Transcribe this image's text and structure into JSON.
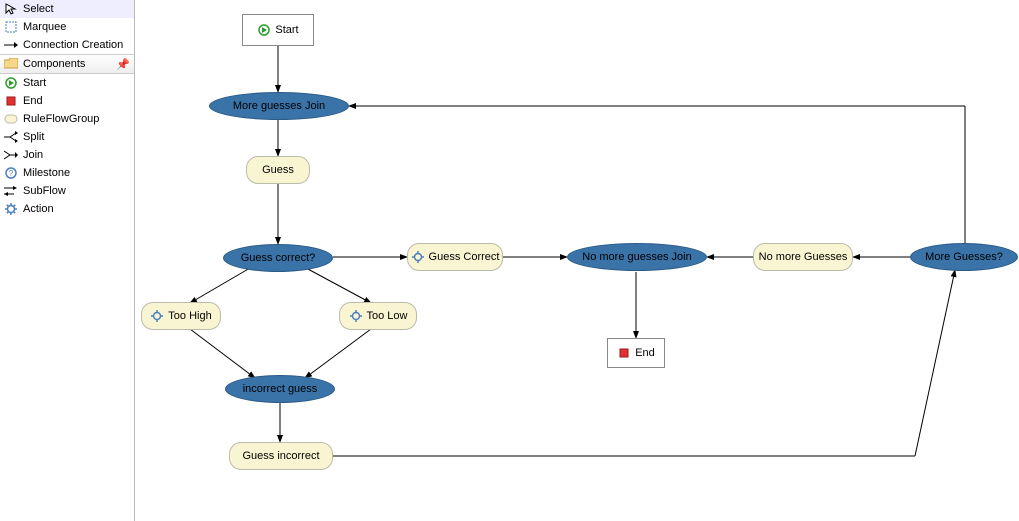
{
  "palette": {
    "tools": {
      "select": "Select",
      "marquee": "Marquee",
      "connection": "Connection Creation"
    },
    "section": {
      "components": "Components"
    },
    "components": {
      "start": "Start",
      "end": "End",
      "ruleflow_group": "RuleFlowGroup",
      "split": "Split",
      "join": "Join",
      "milestone": "Milestone",
      "subflow": "SubFlow",
      "action": "Action"
    }
  },
  "nodes": {
    "start": {
      "label": "Start"
    },
    "more_guesses_join": {
      "label": "More guesses Join"
    },
    "guess": {
      "label": "Guess"
    },
    "guess_correct_split": {
      "label": "Guess  correct?"
    },
    "guess_correct": {
      "label": "Guess Correct"
    },
    "too_high": {
      "label": "Too High"
    },
    "too_low": {
      "label": "Too Low"
    },
    "incorrect_guess": {
      "label": "incorrect guess"
    },
    "guess_incorrect": {
      "label": "Guess incorrect"
    },
    "no_more_guesses_join": {
      "label": "No more guesses Join"
    },
    "no_more_guesses": {
      "label": "No more Guesses"
    },
    "more_guesses_split": {
      "label": "More Guesses?"
    },
    "end": {
      "label": "End"
    }
  },
  "diagram": {
    "type": "ruleflow",
    "edges": [
      {
        "from": "start",
        "to": "more_guesses_join"
      },
      {
        "from": "more_guesses_join",
        "to": "guess"
      },
      {
        "from": "guess",
        "to": "guess_correct_split"
      },
      {
        "from": "guess_correct_split",
        "to": "guess_correct"
      },
      {
        "from": "guess_correct",
        "to": "no_more_guesses_join"
      },
      {
        "from": "guess_correct_split",
        "to": "too_high"
      },
      {
        "from": "guess_correct_split",
        "to": "too_low"
      },
      {
        "from": "too_high",
        "to": "incorrect_guess"
      },
      {
        "from": "too_low",
        "to": "incorrect_guess"
      },
      {
        "from": "incorrect_guess",
        "to": "guess_incorrect"
      },
      {
        "from": "guess_incorrect",
        "to": "more_guesses_split"
      },
      {
        "from": "more_guesses_split",
        "to": "no_more_guesses"
      },
      {
        "from": "no_more_guesses",
        "to": "no_more_guesses_join"
      },
      {
        "from": "more_guesses_split",
        "to": "more_guesses_join"
      },
      {
        "from": "no_more_guesses_join",
        "to": "end"
      }
    ]
  }
}
